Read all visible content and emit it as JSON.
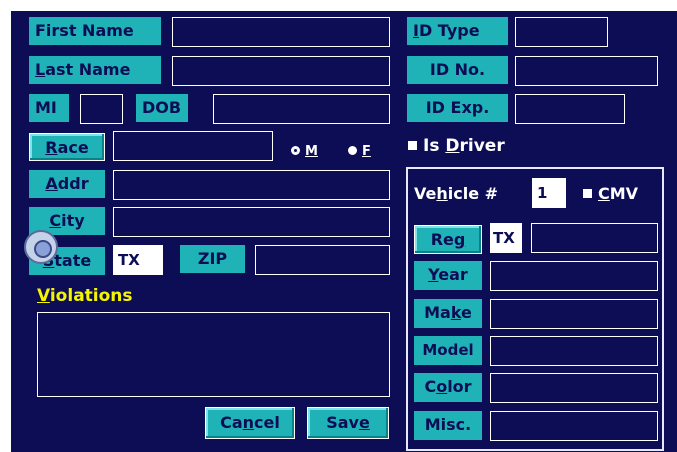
{
  "person": {
    "first_name": {
      "pre": "",
      "key": "",
      "post": "First Name",
      "value": ""
    },
    "last_name": {
      "pre": "",
      "key": "L",
      "post": "ast Name",
      "value": ""
    },
    "mi": {
      "label": "MI",
      "value": ""
    },
    "dob": {
      "label": "DOB",
      "value": ""
    },
    "race": {
      "pre": "",
      "key": "R",
      "post": "ace",
      "value": ""
    },
    "sex": {
      "m_key": "M",
      "f_key": "F",
      "selected": "M"
    },
    "addr": {
      "pre": "",
      "key": "A",
      "post": "ddr",
      "value": ""
    },
    "city": {
      "pre": "",
      "key": "C",
      "post": "ity",
      "value": ""
    },
    "state": {
      "pre": "",
      "key": "S",
      "post": "tate",
      "value": "TX"
    },
    "zip": {
      "label": "ZIP",
      "value": ""
    }
  },
  "id": {
    "type": {
      "pre": "",
      "key": "I",
      "post": "D Type",
      "value": ""
    },
    "number": {
      "label": "ID No.",
      "value": ""
    },
    "expiry": {
      "label": "ID Exp.",
      "value": ""
    },
    "is_driver": {
      "pre": "Is ",
      "key": "D",
      "post": "river",
      "checked": true
    }
  },
  "violations": {
    "pre": "",
    "key": "V",
    "post": "iolations",
    "value": ""
  },
  "actions": {
    "cancel": {
      "pre": "Ca",
      "key": "n",
      "post": "cel"
    },
    "save": {
      "pre": "Sav",
      "key": "e",
      "post": ""
    }
  },
  "vehicle": {
    "title": {
      "pre": "Ve",
      "key": "h",
      "post": "icle #"
    },
    "number": "1",
    "cmv": {
      "pre": "",
      "key": "C",
      "post": "MV",
      "checked": true
    },
    "reg": {
      "pre": "Re",
      "key": "g",
      "post": "",
      "state": "TX",
      "value": ""
    },
    "year": {
      "pre": "",
      "key": "Y",
      "post": "ear",
      "value": ""
    },
    "make": {
      "pre": "Ma",
      "key": "k",
      "post": "e",
      "value": ""
    },
    "model": {
      "label": "Model",
      "value": ""
    },
    "color": {
      "pre": "C",
      "key": "o",
      "post": "lor",
      "value": ""
    },
    "misc": {
      "label": "Misc.",
      "value": ""
    }
  },
  "colors": {
    "background": "#0d0d55",
    "label_bg": "#1fb3b8",
    "accent": "#f5f500",
    "text": "#ffffff"
  }
}
